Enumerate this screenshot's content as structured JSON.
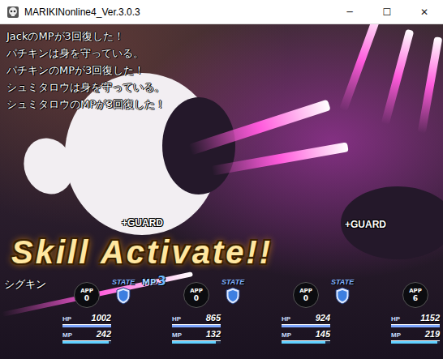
{
  "window": {
    "title": "MARIKINonline4_Ver.3.0.3",
    "controls": [
      "─",
      "☐",
      "✕"
    ]
  },
  "log": [
    "JackのMPが3回復した！",
    "パチキンは身を守っている。",
    "パチキンのMPが3回復した！",
    "シュミタロウは身を守っている。",
    "シュミタロウのMPが3回復した！"
  ],
  "banner": {
    "text": "Skill Activate!!"
  },
  "party_name": "シグキン",
  "members": [
    {
      "app_label": "APP",
      "app": "0",
      "state": {
        "label": "STATE",
        "guarding": true
      },
      "guard_popup": "+GUARD",
      "mp_popup": {
        "label": "MP",
        "value": "3"
      },
      "hp_label": "HP",
      "hp": "1002",
      "hp_level": 1.0,
      "mp_label": "MP",
      "mp": "242",
      "mp_level": 0.95
    },
    {
      "app_label": "APP",
      "app": "0",
      "state": {
        "label": "STATE",
        "guarding": true
      },
      "guard_popup": null,
      "mp_popup": null,
      "hp_label": "HP",
      "hp": "865",
      "hp_level": 1.0,
      "mp_label": "MP",
      "mp": "132",
      "mp_level": 0.9
    },
    {
      "app_label": "APP",
      "app": "0",
      "state": {
        "label": "STATE",
        "guarding": true
      },
      "guard_popup": "+GUARD",
      "mp_popup": null,
      "hp_label": "HP",
      "hp": "924",
      "hp_level": 1.0,
      "mp_label": "MP",
      "mp": "145",
      "mp_level": 0.9
    },
    {
      "app_label": "APP",
      "app": "6",
      "state": null,
      "guard_popup": null,
      "mp_popup": null,
      "hp_label": "HP",
      "hp": "1152",
      "hp_level": 1.0,
      "mp_label": "MP",
      "mp": "219",
      "mp_level": 0.95
    }
  ]
}
